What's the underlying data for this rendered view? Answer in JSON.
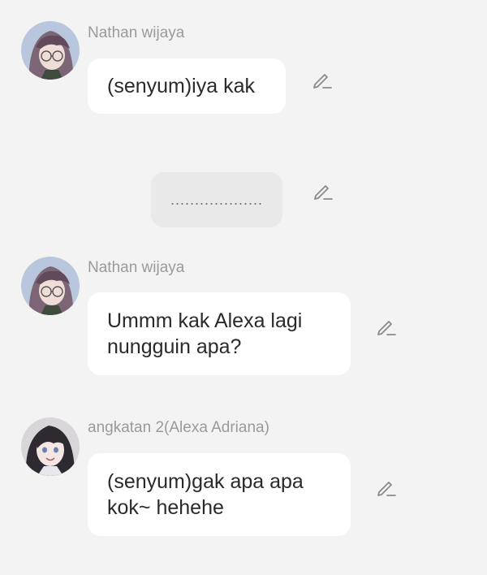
{
  "messages": [
    {
      "sender": "Nathan wijaya",
      "text": "(senyum)iya kak",
      "avatar": "avatar-boy-glasses"
    },
    {
      "text": "..................."
    },
    {
      "sender": "Nathan wijaya",
      "text": "Ummm kak Alexa lagi nungguin apa?",
      "avatar": "avatar-boy-glasses"
    },
    {
      "sender": "angkatan 2(Alexa Adriana)",
      "text": "(senyum)gak apa apa kok~ hehehe",
      "avatar": "avatar-girl-dark-hair"
    }
  ],
  "icons": {
    "edit": "edit-pencil-icon"
  },
  "colors": {
    "background": "#f3f3f3",
    "bubble": "#ffffff",
    "center_bubble": "#e9e9e9",
    "name": "#9a9a9a",
    "text": "#2a2a2a",
    "icon": "#8a8a8a"
  }
}
